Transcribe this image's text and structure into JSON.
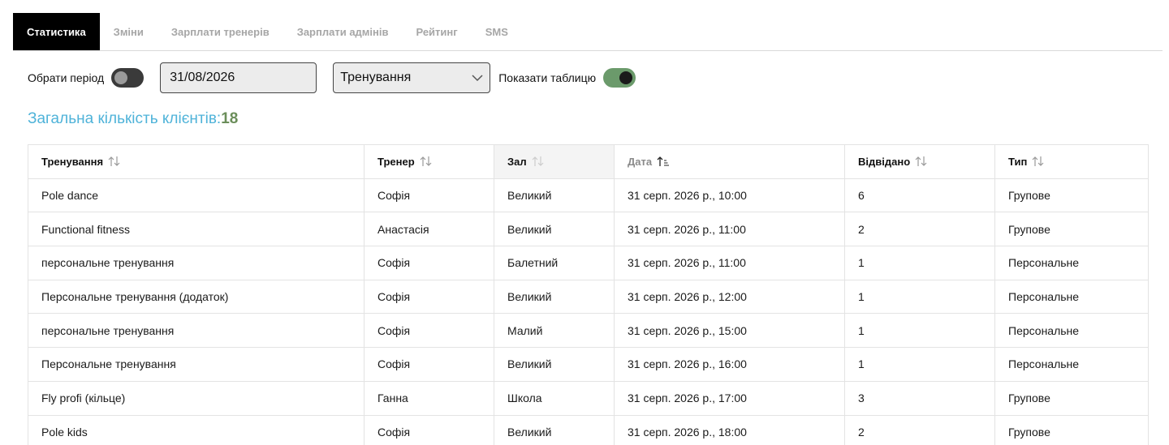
{
  "tabs": [
    {
      "label": "Статистика",
      "active": true
    },
    {
      "label": "Зміни",
      "active": false
    },
    {
      "label": "Зарплати тренерів",
      "active": false
    },
    {
      "label": "Зарплати адмінів",
      "active": false
    },
    {
      "label": "Рейтинг",
      "active": false
    },
    {
      "label": "SMS",
      "active": false
    }
  ],
  "filters": {
    "period_label": "Обрати період",
    "period_toggle_on": false,
    "date_value": "31/08/2026",
    "type_select_value": "Тренування",
    "show_table_label": "Показати таблицю",
    "show_table_on": true
  },
  "summary": {
    "label": "Загальна кількість клієнтів:",
    "count": "18"
  },
  "table": {
    "columns": [
      "Тренування",
      "Тренер",
      "Зал",
      "Дата",
      "Відвідано",
      "Тип"
    ],
    "rows": [
      [
        "Pole dance",
        "Софія",
        "Великий",
        "31 серп. 2026 р., 10:00",
        "6",
        "Групове"
      ],
      [
        "Functional fitness",
        "Анастасія",
        "Великий",
        "31 серп. 2026 р., 11:00",
        "2",
        "Групове"
      ],
      [
        "персональне тренування",
        "Софія",
        "Балетний",
        "31 серп. 2026 р., 11:00",
        "1",
        "Персональне"
      ],
      [
        "Персональне тренування (додаток)",
        "Софія",
        "Великий",
        "31 серп. 2026 р., 12:00",
        "1",
        "Персональне"
      ],
      [
        "персональне тренування",
        "Софія",
        "Малий",
        "31 серп. 2026 р., 15:00",
        "1",
        "Персональне"
      ],
      [
        "Персональне тренування",
        "Софія",
        "Великий",
        "31 серп. 2026 р., 16:00",
        "1",
        "Персональне"
      ],
      [
        "Fly profi (кільце)",
        "Ганна",
        "Школа",
        "31 серп. 2026 р., 17:00",
        "3",
        "Групове"
      ],
      [
        "Pole kids",
        "Софія",
        "Великий",
        "31 серп. 2026 р., 18:00",
        "2",
        "Групове"
      ]
    ]
  },
  "colors": {
    "accent_blue": "#4fb3d9",
    "count_green": "#6b8e5a",
    "toggle_on": "#6b9a6b"
  }
}
